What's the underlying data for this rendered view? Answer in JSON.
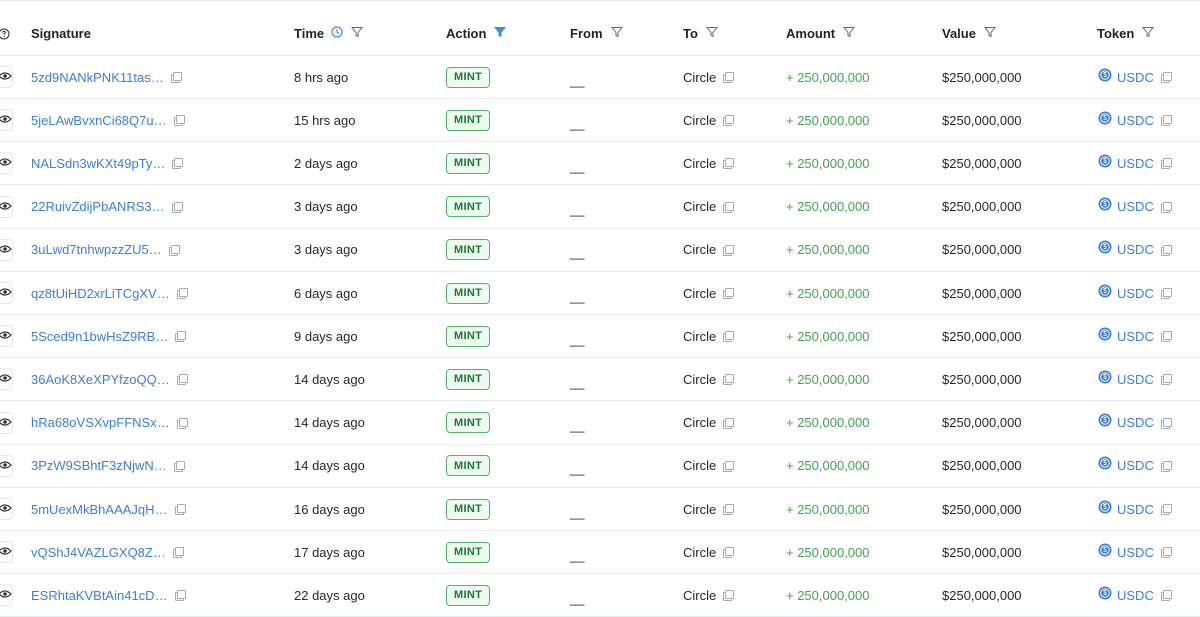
{
  "header": {
    "help_icon": "question-circle-icon",
    "signature": "Signature",
    "time": "Time",
    "action": "Action",
    "from": "From",
    "to": "To",
    "amount": "Amount",
    "value": "Value",
    "token": "Token"
  },
  "colors": {
    "link": "#3b7fd9",
    "positive": "#3fa452",
    "badge_border": "#51b46a",
    "badge_bg": "#eef9f0",
    "active_filter": "#3b8ee6"
  },
  "rows": [
    {
      "signature": "5zd9NANkPNK11tas…",
      "time": "8 hrs ago",
      "action": "MINT",
      "from": "__",
      "to": "Circle",
      "amount": "+ 250,000,000",
      "value": "$250,000,000",
      "token": "USDC"
    },
    {
      "signature": "5jeLAwBvxnCi68Q7u…",
      "time": "15 hrs ago",
      "action": "MINT",
      "from": "__",
      "to": "Circle",
      "amount": "+ 250,000,000",
      "value": "$250,000,000",
      "token": "USDC"
    },
    {
      "signature": "NALSdn3wKXt49pTy…",
      "time": "2 days ago",
      "action": "MINT",
      "from": "__",
      "to": "Circle",
      "amount": "+ 250,000,000",
      "value": "$250,000,000",
      "token": "USDC"
    },
    {
      "signature": "22RuivZdijPbANRS3…",
      "time": "3 days ago",
      "action": "MINT",
      "from": "__",
      "to": "Circle",
      "amount": "+ 250,000,000",
      "value": "$250,000,000",
      "token": "USDC"
    },
    {
      "signature": "3uLwd7tnhwpzzZU5…",
      "time": "3 days ago",
      "action": "MINT",
      "from": "__",
      "to": "Circle",
      "amount": "+ 250,000,000",
      "value": "$250,000,000",
      "token": "USDC"
    },
    {
      "signature": "qz8tUiHD2xrLiTCgXV…",
      "time": "6 days ago",
      "action": "MINT",
      "from": "__",
      "to": "Circle",
      "amount": "+ 250,000,000",
      "value": "$250,000,000",
      "token": "USDC"
    },
    {
      "signature": "5Sced9n1bwHsZ9RB…",
      "time": "9 days ago",
      "action": "MINT",
      "from": "__",
      "to": "Circle",
      "amount": "+ 250,000,000",
      "value": "$250,000,000",
      "token": "USDC"
    },
    {
      "signature": "36AoK8XeXPYfzoQQ…",
      "time": "14 days ago",
      "action": "MINT",
      "from": "__",
      "to": "Circle",
      "amount": "+ 250,000,000",
      "value": "$250,000,000",
      "token": "USDC"
    },
    {
      "signature": "hRa68oVSXvpFFNSx…",
      "time": "14 days ago",
      "action": "MINT",
      "from": "__",
      "to": "Circle",
      "amount": "+ 250,000,000",
      "value": "$250,000,000",
      "token": "USDC"
    },
    {
      "signature": "3PzW9SBhtF3zNjwN…",
      "time": "14 days ago",
      "action": "MINT",
      "from": "__",
      "to": "Circle",
      "amount": "+ 250,000,000",
      "value": "$250,000,000",
      "token": "USDC"
    },
    {
      "signature": "5mUexMkBhAAAJqH…",
      "time": "16 days ago",
      "action": "MINT",
      "from": "__",
      "to": "Circle",
      "amount": "+ 250,000,000",
      "value": "$250,000,000",
      "token": "USDC"
    },
    {
      "signature": "vQShJ4VAZLGXQ8Z…",
      "time": "17 days ago",
      "action": "MINT",
      "from": "__",
      "to": "Circle",
      "amount": "+ 250,000,000",
      "value": "$250,000,000",
      "token": "USDC"
    },
    {
      "signature": "ESRhtaKVBtAin41cD…",
      "time": "22 days ago",
      "action": "MINT",
      "from": "__",
      "to": "Circle",
      "amount": "+ 250,000,000",
      "value": "$250,000,000",
      "token": "USDC"
    }
  ]
}
